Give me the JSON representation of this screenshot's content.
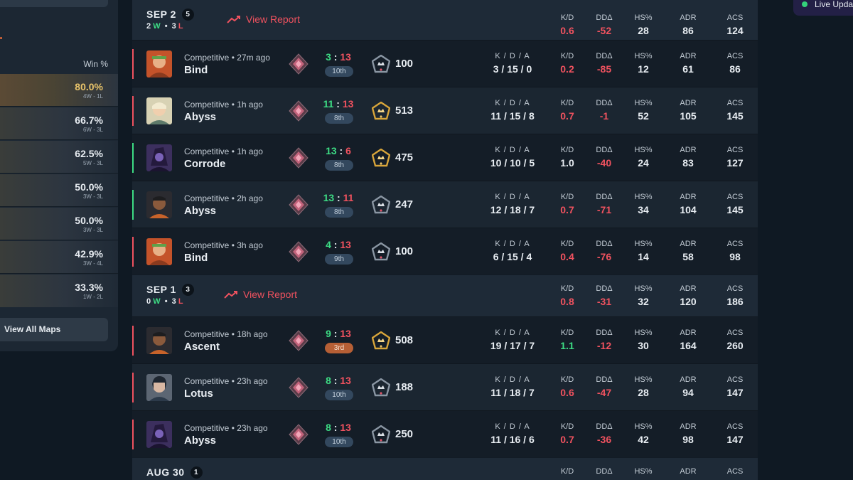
{
  "colors": {
    "win": "#3ddc84",
    "loss": "#f0525f",
    "gold": "#e9c46a",
    "background": "#0f1923",
    "panel": "#131c26"
  },
  "live": {
    "label": "Live Updat"
  },
  "sidebar": {
    "winpct_header": "Win %",
    "maps": [
      {
        "pct": "80.0%",
        "wl": "4W - 1L"
      },
      {
        "pct": "66.7%",
        "wl": "6W - 3L"
      },
      {
        "pct": "62.5%",
        "wl": "5W - 3L"
      },
      {
        "pct": "50.0%",
        "wl": "3W - 3L"
      },
      {
        "pct": "50.0%",
        "wl": "3W - 3L"
      },
      {
        "pct": "42.9%",
        "wl": "3W - 4L"
      },
      {
        "pct": "33.3%",
        "wl": "1W - 2L"
      }
    ],
    "view_all": "View All Maps"
  },
  "labels": {
    "kda": "K / D / A",
    "kd": "K/D",
    "dd": "DDΔ",
    "hs": "HS%",
    "adr": "ADR",
    "acs": "ACS",
    "view_report": "View Report"
  },
  "days": [
    {
      "date": "SEP 2",
      "count": "5",
      "w": "2",
      "w_label": "W",
      "l": "3",
      "l_label": "L",
      "kd": "0.6",
      "dd": "-52",
      "hs": "28",
      "adr": "86",
      "acs": "124"
    },
    {
      "date": "SEP 1",
      "count": "3",
      "w": "0",
      "w_label": "W",
      "l": "3",
      "l_label": "L",
      "kd": "0.8",
      "dd": "-31",
      "hs": "32",
      "adr": "120",
      "acs": "186"
    },
    {
      "date": "AUG 30",
      "count": "1"
    }
  ],
  "matches": [
    {
      "mode": "Competitive • 27m ago",
      "map": "Bind",
      "score_a": "3",
      "score_b": "13",
      "place": "10th",
      "rr": "100",
      "kda": "3 / 15 / 0",
      "kd": "0.2",
      "dd": "-85",
      "hs": "12",
      "adr": "61",
      "acs": "86"
    },
    {
      "mode": "Competitive • 1h ago",
      "map": "Abyss",
      "score_a": "11",
      "score_b": "13",
      "place": "8th",
      "rr": "513",
      "kda": "11 / 15 / 8",
      "kd": "0.7",
      "dd": "-1",
      "hs": "52",
      "adr": "105",
      "acs": "145"
    },
    {
      "mode": "Competitive • 1h ago",
      "map": "Corrode",
      "score_a": "13",
      "score_b": "6",
      "place": "8th",
      "rr": "475",
      "kda": "10 / 10 / 5",
      "kd": "1.0",
      "dd": "-40",
      "hs": "24",
      "adr": "83",
      "acs": "127"
    },
    {
      "mode": "Competitive • 2h ago",
      "map": "Abyss",
      "score_a": "13",
      "score_b": "11",
      "place": "8th",
      "rr": "247",
      "kda": "12 / 18 / 7",
      "kd": "0.7",
      "dd": "-71",
      "hs": "34",
      "adr": "104",
      "acs": "145"
    },
    {
      "mode": "Competitive • 3h ago",
      "map": "Bind",
      "score_a": "4",
      "score_b": "13",
      "place": "9th",
      "rr": "100",
      "kda": "6 / 15 / 4",
      "kd": "0.4",
      "dd": "-76",
      "hs": "14",
      "adr": "58",
      "acs": "98"
    },
    {
      "mode": "Competitive • 18h ago",
      "map": "Ascent",
      "score_a": "9",
      "score_b": "13",
      "place": "3rd",
      "rr": "508",
      "kda": "19 / 17 / 7",
      "kd": "1.1",
      "dd": "-12",
      "hs": "30",
      "adr": "164",
      "acs": "260"
    },
    {
      "mode": "Competitive • 23h ago",
      "map": "Lotus",
      "score_a": "8",
      "score_b": "13",
      "place": "10th",
      "rr": "188",
      "kda": "11 / 18 / 7",
      "kd": "0.6",
      "dd": "-47",
      "hs": "28",
      "adr": "94",
      "acs": "147"
    },
    {
      "mode": "Competitive • 23h ago",
      "map": "Abyss",
      "score_a": "8",
      "score_b": "13",
      "place": "10th",
      "rr": "250",
      "kda": "11 / 16 / 6",
      "kd": "0.7",
      "dd": "-36",
      "hs": "42",
      "adr": "98",
      "acs": "147"
    }
  ]
}
